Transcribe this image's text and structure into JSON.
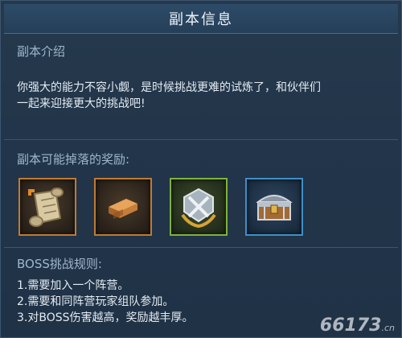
{
  "dialog": {
    "title": "副本信息"
  },
  "intro": {
    "heading": "副本介绍",
    "line1": "你强大的能力不容小觑，是时候挑战更难的试炼了，和伙伴们",
    "line2": "一起来迎接更大的挑战吧!"
  },
  "rewards": {
    "heading": "副本可能掉落的奖励:",
    "items": [
      {
        "icon": "scroll-icon",
        "frame_color": "#c07a33"
      },
      {
        "icon": "bronze-ingot-icon",
        "frame_color": "#c07a33"
      },
      {
        "icon": "crossed-swords-emblem-icon",
        "frame_color": "#7fb23a"
      },
      {
        "icon": "treasure-chest-icon",
        "frame_color": "#3e8fc8"
      }
    ]
  },
  "rules": {
    "heading": "BOSS挑战规则:",
    "items": [
      "1.需要加入一个阵营。",
      "2.需要和同阵营玩家组队参加。",
      "3.对BOSS伤害越高，奖励越丰厚。"
    ]
  },
  "watermark": {
    "brand": "66173",
    "suffix": ".cn"
  }
}
